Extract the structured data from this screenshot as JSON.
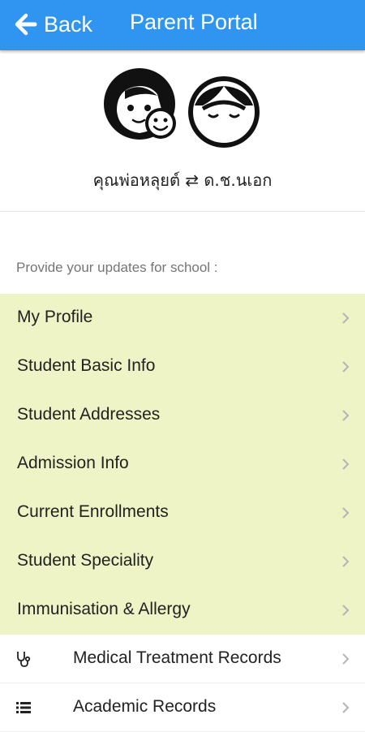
{
  "header": {
    "back_label": "Back",
    "title": "Parent Portal",
    "background": "#2f95f0"
  },
  "relation": {
    "text": "คุณพ่อหลุยต์ ⇄ ด.ช.นเอก"
  },
  "section": {
    "label": "Provide your updates for school :"
  },
  "menu": {
    "highlight_color": "#eef4c6",
    "items": [
      {
        "label": "My Profile"
      },
      {
        "label": "Student Basic Info"
      },
      {
        "label": "Student Addresses"
      },
      {
        "label": "Admission Info"
      },
      {
        "label": "Current Enrollments"
      },
      {
        "label": "Student Speciality"
      },
      {
        "label": "Immunisation & Allergy"
      },
      {
        "label": "Medical Treatment Records",
        "icon": "stethoscope-icon"
      },
      {
        "label": "Academic Records",
        "icon": "list-icon"
      }
    ]
  }
}
